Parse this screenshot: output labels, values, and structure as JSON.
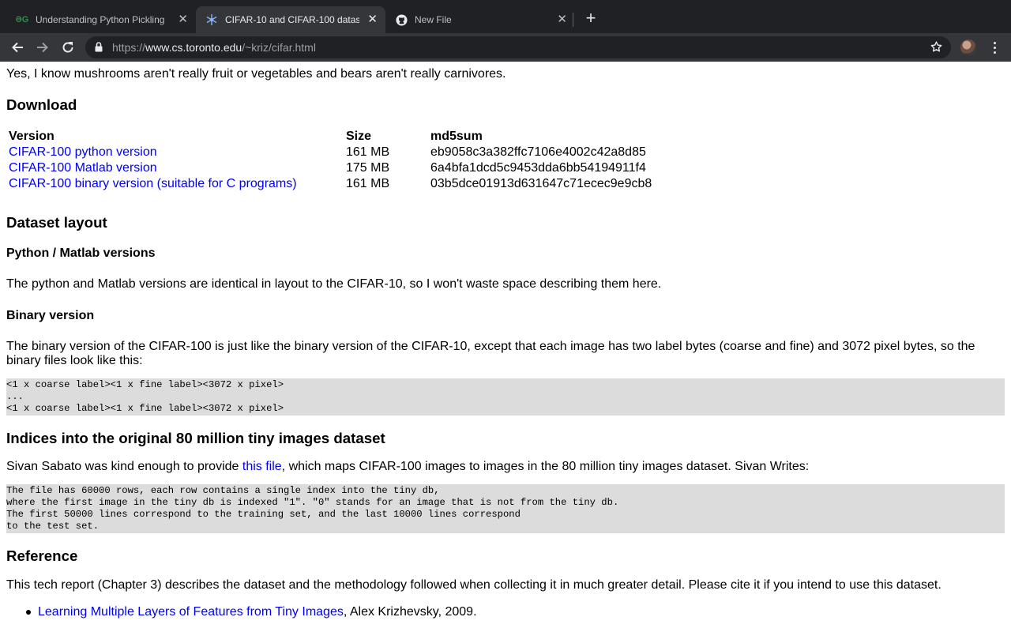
{
  "browser": {
    "tabs": [
      {
        "title": "Understanding Python Pickling",
        "active": false,
        "icon": "geeksforgeeks-icon"
      },
      {
        "title": "CIFAR-10 and CIFAR-100 datas",
        "active": true,
        "icon": "snowflake-icon"
      },
      {
        "title": "New File",
        "active": false,
        "icon": "github-icon"
      }
    ],
    "new_tab": "+",
    "url": {
      "scheme": "https://",
      "host": "www.cs.toronto.edu",
      "path": "/~kriz/cifar.html"
    }
  },
  "page": {
    "intro": "Yes, I know mushrooms aren't really fruit or vegetables and bears aren't really carnivores.",
    "download": {
      "heading": "Download",
      "columns": [
        "Version",
        "Size",
        "md5sum"
      ],
      "rows": [
        {
          "version": "CIFAR-100 python version",
          "size": "161 MB",
          "md5": "eb9058c3a382ffc7106e4002c42a8d85"
        },
        {
          "version": "CIFAR-100 Matlab version",
          "size": "175 MB",
          "md5": "6a4bfa1dcd5c9453dda6bb54194911f4"
        },
        {
          "version": "CIFAR-100 binary version (suitable for C programs)",
          "size": "161 MB",
          "md5": "03b5dce01913d631647c71ecec9e9cb8"
        }
      ]
    },
    "layout": {
      "heading": "Dataset layout",
      "python_heading": "Python / Matlab versions",
      "python_text": "The python and Matlab versions are identical in layout to the CIFAR-10, so I won't waste space describing them here.",
      "binary_heading": "Binary version",
      "binary_text": "The binary version of the CIFAR-100 is just like the binary version of the CIFAR-10, except that each image has two label bytes (coarse and fine) and 3072 pixel bytes, so the binary files look like this:",
      "binary_code": "<1 x coarse label><1 x fine label><3072 x pixel>\n...\n<1 x coarse label><1 x fine label><3072 x pixel>"
    },
    "indices": {
      "heading": "Indices into the original 80 million tiny images dataset",
      "text_before": "Sivan Sabato was kind enough to provide ",
      "link": "this file",
      "text_after": ", which maps CIFAR-100 images to images in the 80 million tiny images dataset. Sivan Writes:",
      "code": "The file has 60000 rows, each row contains a single index into the tiny db,\nwhere the first image in the tiny db is indexed \"1\". \"0\" stands for an image that is not from the tiny db.\nThe first 50000 lines correspond to the training set, and the last 10000 lines correspond\nto the test set."
    },
    "reference": {
      "heading": "Reference",
      "text": "This tech report (Chapter 3) describes the dataset and the methodology followed when collecting it in much greater detail. Please cite it if you intend to use this dataset.",
      "item_link": "Learning Multiple Layers of Features from Tiny Images",
      "item_rest": ", Alex Krizhevsky, 2009."
    }
  }
}
